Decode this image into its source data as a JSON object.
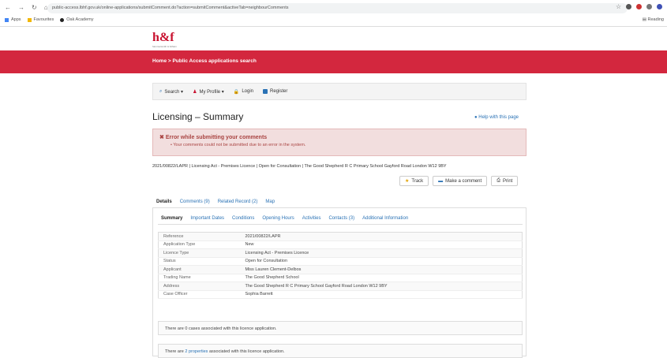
{
  "browser": {
    "url": "public-access.lbhf.gov.uk/online-applications/submitComment.do?action=submitComment&activeTab=neighbourComments",
    "bookmarks": [
      "Apps",
      "Favourites",
      "Oak Academy"
    ],
    "reading_list": "Reading"
  },
  "site": {
    "logo": "h&f",
    "logo_sub": "hammersmith & fulham",
    "breadcrumb": "Home  >  Public Access applications search"
  },
  "toolbar": {
    "search": "Search ▾",
    "profile": "My Profile ▾",
    "login": "Login",
    "register": "Register"
  },
  "page": {
    "title": "Licensing – Summary",
    "help": "Help with this page",
    "error_title": "Error while submitting your comments",
    "error_msg": "Your comments could not be submitted due to an error in the system.",
    "summary_line": "2021/00822/LAPR | Licensing Act - Premises Licence | Open for Consultation | The Good Shepherd R C Primary School Gayford Road London W12 9BY"
  },
  "actions": {
    "track": "Track",
    "comment": "Make a comment",
    "print": "Print"
  },
  "tabs": [
    {
      "label": "Details",
      "active": true
    },
    {
      "label": "Comments (9)",
      "active": false
    },
    {
      "label": "Related Record (2)",
      "active": false
    },
    {
      "label": "Map",
      "active": false
    }
  ],
  "subtabs": [
    {
      "label": "Summary",
      "active": true
    },
    {
      "label": "Important Dates",
      "active": false
    },
    {
      "label": "Conditions",
      "active": false
    },
    {
      "label": "Opening Hours",
      "active": false
    },
    {
      "label": "Activities",
      "active": false
    },
    {
      "label": "Contacts (3)",
      "active": false
    },
    {
      "label": "Additional Information",
      "active": false
    }
  ],
  "details": [
    [
      "Reference",
      "2021/00822/LAPR"
    ],
    [
      "Application Type",
      "New"
    ],
    [
      "Licence Type",
      "Licensing Act - Premises Licence"
    ],
    [
      "Status",
      "Open for Consultation"
    ],
    [
      "Applicant",
      "Miss Lauren Clement-Delbos"
    ],
    [
      "Trading Name",
      "The Good Shepherd School"
    ],
    [
      "Address",
      "The Good Shepherd R C Primary School Gayford Road London W12 9BY"
    ],
    [
      "Case Officer",
      "Sophia Barrett"
    ]
  ],
  "cases_note": "There are 0 cases associated with this licence application.",
  "props_pre": "There are ",
  "props_link": "2 properties",
  "props_post": " associated with this licence application.",
  "colors": {
    "brand": "#d3273e",
    "link": "#2a72b5",
    "error_bg": "#f2dede"
  }
}
